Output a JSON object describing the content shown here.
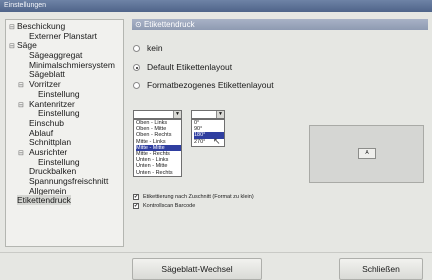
{
  "window": {
    "title": "Einstellungen"
  },
  "tree": {
    "items": [
      {
        "label": "Beschickung",
        "level": 0,
        "expander": "⊟"
      },
      {
        "label": "Externer Planstart",
        "level": 1
      },
      {
        "label": "Säge",
        "level": 0,
        "expander": "⊟"
      },
      {
        "label": "Sägeaggregat",
        "level": 1
      },
      {
        "label": "Minimalschmiersystem",
        "level": 1
      },
      {
        "label": "Sägeblatt",
        "level": 1
      },
      {
        "label": "Vorritzer",
        "level": 1,
        "expander": "⊟"
      },
      {
        "label": "Einstellung",
        "level": 2
      },
      {
        "label": "Kantenritzer",
        "level": 1,
        "expander": "⊟"
      },
      {
        "label": "Einstellung",
        "level": 2
      },
      {
        "label": "Einschub",
        "level": 1
      },
      {
        "label": "Ablauf",
        "level": 1
      },
      {
        "label": "Schnittplan",
        "level": 1
      },
      {
        "label": "Ausrichter",
        "level": 1,
        "expander": "⊟"
      },
      {
        "label": "Einstellung",
        "level": 2
      },
      {
        "label": "Druckbalken",
        "level": 1
      },
      {
        "label": "Spannungsfreischnitt",
        "level": 1
      },
      {
        "label": "Allgemein",
        "level": 1
      },
      {
        "label": "Etikettendruck",
        "level": 0,
        "selected": true
      }
    ]
  },
  "panel": {
    "header": "Etikettendruck",
    "header_icon": "⊙",
    "radio_options": [
      {
        "label": "kein",
        "checked": false
      },
      {
        "label": "Default Etikettenlayout",
        "checked": true
      },
      {
        "label": "Formatbezogenes Etikettenlayout",
        "checked": false
      }
    ],
    "position_list": {
      "options": [
        "Oben - Links",
        "Oben - Mitte",
        "Oben - Rechts",
        "Mitte - Links",
        "Mitte - Mitte",
        "Mitte - Rechts",
        "Unten - Links",
        "Unten - Mitte",
        "Unten - Rechts"
      ],
      "selected_index": 4
    },
    "angle_list": {
      "options": [
        "0°",
        "90°",
        "180°",
        "270°"
      ],
      "selected_index": 2
    },
    "checkboxes": [
      {
        "label": "Etikettierung nach Zuschnitt (Format zu klein)",
        "checked": true
      },
      {
        "label": "Kontrollscan Barcode",
        "checked": true
      }
    ],
    "preview_label": "A"
  },
  "footer": {
    "saw_blade_change": "Sägeblatt-Wechsel",
    "close": "Schließen"
  },
  "icons": {
    "dropdown_arrow": "▼",
    "check": "✔",
    "cursor": "↖"
  },
  "colors": {
    "titlebar": "#5c7196",
    "selection": "#2f3ea0",
    "panel_header": "#9aa4bb"
  }
}
